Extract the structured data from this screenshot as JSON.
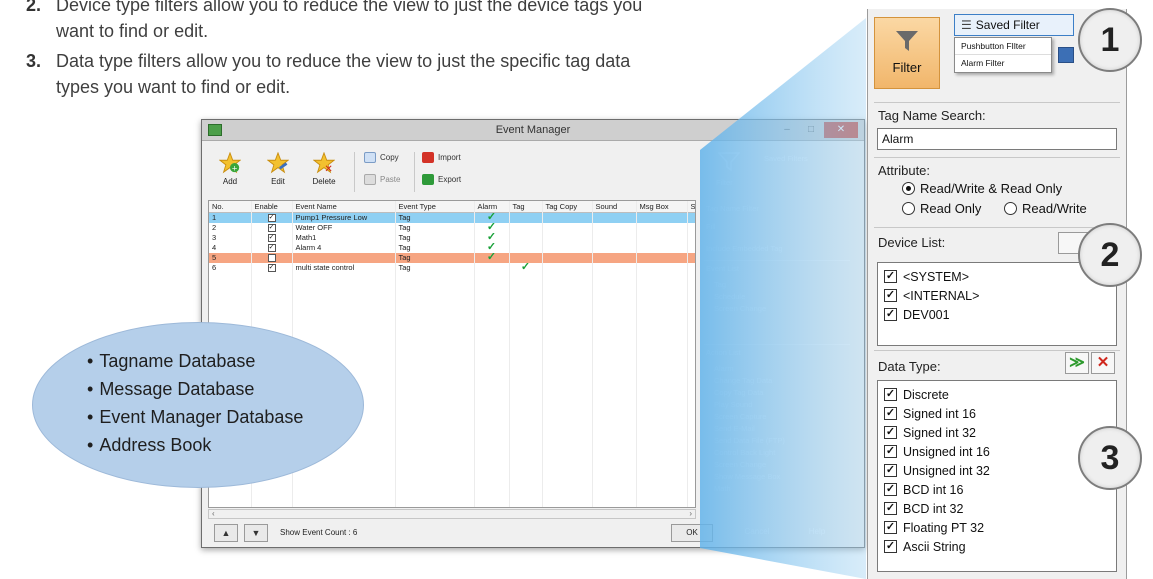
{
  "doc": {
    "items": [
      {
        "num": "2.",
        "text_1": "Device type filters allow you to reduce the view to just the device tags you",
        "text_2": "want to find or edit."
      },
      {
        "num": "3.",
        "text_1": "Data type filters allow you to reduce the view to just the specific tag data",
        "text_2": "types you want to find or edit."
      }
    ]
  },
  "window": {
    "title": "Event Manager",
    "toolbar": {
      "add": "Add",
      "edit": "Edit",
      "delete": "Delete",
      "copy": "Copy",
      "paste": "Paste",
      "import": "Import",
      "export": "Export"
    },
    "columns": [
      "No.",
      "Enable",
      "Event Name",
      "Event Type",
      "Alarm",
      "Tag",
      "Tag Copy",
      "Sound",
      "Msg Box",
      "S"
    ],
    "rows": [
      {
        "no": "1",
        "enable": true,
        "name": "Pump1 Pressure Low",
        "type": "Tag",
        "alarm": true,
        "tag": false,
        "style": "sel"
      },
      {
        "no": "2",
        "enable": true,
        "name": "Water OFF",
        "type": "Tag",
        "alarm": true,
        "tag": false,
        "style": ""
      },
      {
        "no": "3",
        "enable": true,
        "name": "Math1",
        "type": "Tag",
        "alarm": true,
        "tag": false,
        "style": ""
      },
      {
        "no": "4",
        "enable": true,
        "name": "Alarm 4",
        "type": "Tag",
        "alarm": true,
        "tag": false,
        "style": ""
      },
      {
        "no": "5",
        "enable": false,
        "name": "",
        "type": "Tag",
        "alarm": true,
        "tag": false,
        "style": "warn"
      },
      {
        "no": "6",
        "enable": true,
        "name": "multi state control",
        "type": "Tag",
        "alarm": false,
        "tag": true,
        "style": ""
      }
    ],
    "status": {
      "event_count": "Show Event Count : 6",
      "ok": "OK",
      "cancel": "Cancel",
      "help": "Help"
    },
    "ghost_panel": {
      "filter": "Filter",
      "saved_filters": "Saved Filters",
      "tag_name_filter": "Tag Name Filter",
      "fill": "Fill",
      "include_embedded": "Include Embedded Tag",
      "event_list": "Event List",
      "event_items": [
        "Tag",
        "Schedule",
        "Screen Change"
      ],
      "action_list": "Action List",
      "action_items": [
        "Alarm",
        "Change Tag Data",
        "Copy Tag Data",
        "Play Sound",
        "Screen Capture",
        "Send E-Mail",
        "Send Data File (FTP)",
        "Control Back Light",
        "Screen Change",
        "Show Message Box",
        "Math"
      ]
    }
  },
  "panel": {
    "filter_label": "Filter",
    "saved_filters_label": "Saved Filter",
    "saved_menu": [
      "Pushbutton FIlter",
      "Alarm Filter"
    ],
    "tag_name_search_label": "Tag Name Search:",
    "tag_name_search_value": "Alarm",
    "attribute_label": "Attribute:",
    "attr_options": [
      {
        "label": "Read/Write & Read Only",
        "selected": true
      },
      {
        "label": "Read Only",
        "selected": false
      },
      {
        "label": "Read/Write",
        "selected": false
      }
    ],
    "device_list_label": "Device List:",
    "devices": [
      "<SYSTEM>",
      "<INTERNAL>",
      "DEV001"
    ],
    "data_type_label": "Data Type:",
    "data_types": [
      "Discrete",
      "Signed int 16",
      "Signed int 32",
      "Unsigned int 16",
      "Unsigned int 32",
      "BCD int 16",
      "BCD int 32",
      "Floating PT 32",
      "Ascii String"
    ]
  },
  "badges": [
    "1",
    "2",
    "3"
  ],
  "databases": [
    "Tagname Database",
    "Message Database",
    "Event Manager Database",
    "Address Book"
  ],
  "colors": {
    "selected_row": "#8fd0f3",
    "warn_row": "#f6a582",
    "callout_blue": "#5aaee6",
    "ellipse": "#b5cfea",
    "filter_active": "#f1b66b"
  }
}
